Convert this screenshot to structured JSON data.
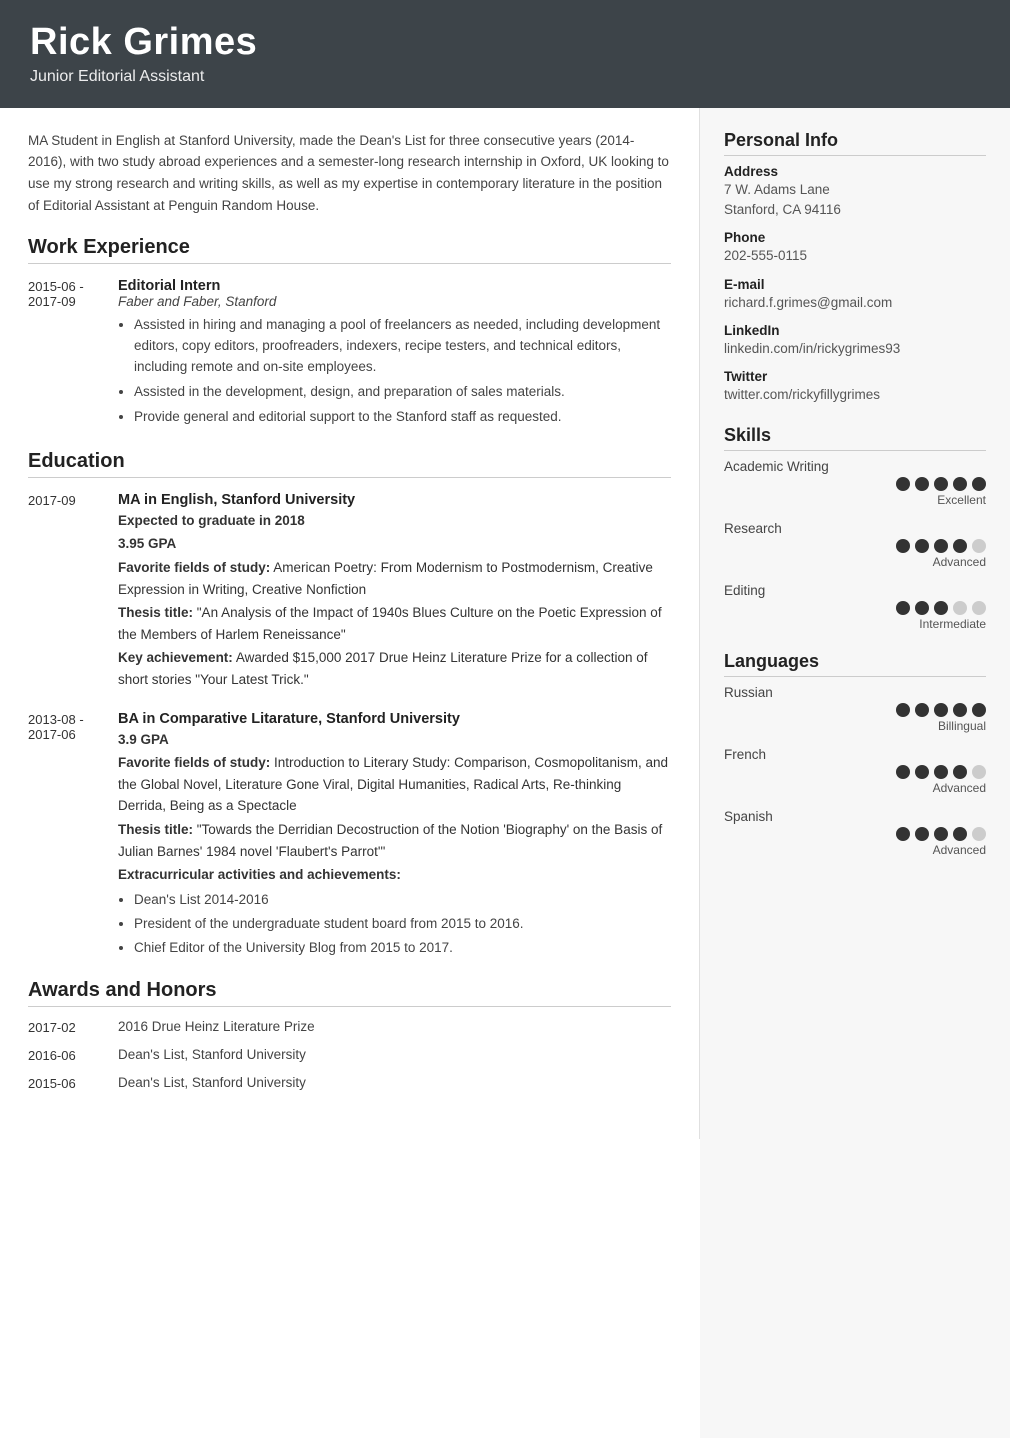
{
  "header": {
    "name": "Rick Grimes",
    "title": "Junior Editorial Assistant"
  },
  "summary": "MA Student in English at Stanford University, made the Dean's List for three consecutive years (2014-2016), with two study abroad experiences and a semester-long research internship in Oxford, UK looking to use my strong research and writing skills, as well as my expertise in contemporary literature in the position of Editorial Assistant at Penguin Random House.",
  "work_experience": {
    "section_title": "Work Experience",
    "items": [
      {
        "date": "2015-06 -\n2017-09",
        "role": "Editorial Intern",
        "company": "Faber and Faber, Stanford",
        "bullets": [
          "Assisted in hiring and managing a pool of freelancers as needed, including development editors, copy editors, proofreaders, indexers, recipe testers, and technical editors, including remote and on-site employees.",
          "Assisted in the development, design, and preparation of sales materials.",
          "Provide general and editorial support to the Stanford staff as requested."
        ]
      }
    ]
  },
  "education": {
    "section_title": "Education",
    "items": [
      {
        "date": "2017-09",
        "degree": "MA in English, Stanford University",
        "lines": [
          {
            "bold": true,
            "text": "Expected to graduate in 2018"
          },
          {
            "bold": true,
            "text": "3.95 GPA"
          },
          {
            "bold_prefix": "Favorite fields of study:",
            "text": " American Poetry: From Modernism to Postmodernism, Creative Expression in Writing, Creative Nonfiction"
          },
          {
            "bold_prefix": "Thesis title:",
            "text": " \"An Analysis of the Impact of 1940s Blues Culture on the Poetic Expression of the Members of Harlem Reneissance\""
          },
          {
            "bold_prefix": "Key achievement:",
            "text": " Awarded $15,000 2017 Drue Heinz Literature Prize for a collection of short stories \"Your Latest Trick.\""
          }
        ]
      },
      {
        "date": "2013-08 -\n2017-06",
        "degree": "BA in Comparative Litarature, Stanford University",
        "lines": [
          {
            "bold": true,
            "text": "3.9 GPA"
          },
          {
            "bold_prefix": "Favorite fields of study:",
            "text": " Introduction to Literary Study: Comparison, Cosmopolitanism, and the Global Novel, Literature Gone Viral, Digital Humanities, Radical Arts, Re-thinking Derrida, Being as a Spectacle"
          },
          {
            "bold_prefix": "Thesis title:",
            "text": " \"Towards the Derridian Decostruction of the Notion 'Biography' on the Basis of Julian Barnes' 1984 novel 'Flaubert's Parrot'\""
          },
          {
            "bold_prefix": "Extracurricular activities and achievements:",
            "text": ""
          }
        ],
        "bullets": [
          "Dean's List 2014-2016",
          "President of the undergraduate student board from 2015 to 2016.",
          "Chief Editor of the University Blog from 2015 to 2017."
        ]
      }
    ]
  },
  "awards": {
    "section_title": "Awards and Honors",
    "items": [
      {
        "date": "2017-02",
        "text": "2016 Drue Heinz Literature Prize"
      },
      {
        "date": "2016-06",
        "text": "Dean's List, Stanford University"
      },
      {
        "date": "2015-06",
        "text": "Dean's List, Stanford University"
      }
    ]
  },
  "personal_info": {
    "section_title": "Personal Info",
    "address_label": "Address",
    "address_line1": "7 W. Adams Lane",
    "address_line2": "Stanford, CA 94116",
    "phone_label": "Phone",
    "phone": "202-555-0115",
    "email_label": "E-mail",
    "email": "richard.f.grimes@gmail.com",
    "linkedin_label": "LinkedIn",
    "linkedin": "linkedin.com/in/rickygrimes93",
    "twitter_label": "Twitter",
    "twitter": "twitter.com/rickyfillygrimes"
  },
  "skills": {
    "section_title": "Skills",
    "items": [
      {
        "name": "Academic Writing",
        "filled": 5,
        "total": 5,
        "level": "Excellent"
      },
      {
        "name": "Research",
        "filled": 4,
        "total": 5,
        "level": "Advanced"
      },
      {
        "name": "Editing",
        "filled": 3,
        "total": 5,
        "level": "Intermediate"
      }
    ]
  },
  "languages": {
    "section_title": "Languages",
    "items": [
      {
        "name": "Russian",
        "filled": 5,
        "total": 5,
        "level": "Billingual"
      },
      {
        "name": "French",
        "filled": 4,
        "total": 5,
        "level": "Advanced"
      },
      {
        "name": "Spanish",
        "filled": 4,
        "total": 5,
        "level": "Advanced"
      }
    ]
  }
}
